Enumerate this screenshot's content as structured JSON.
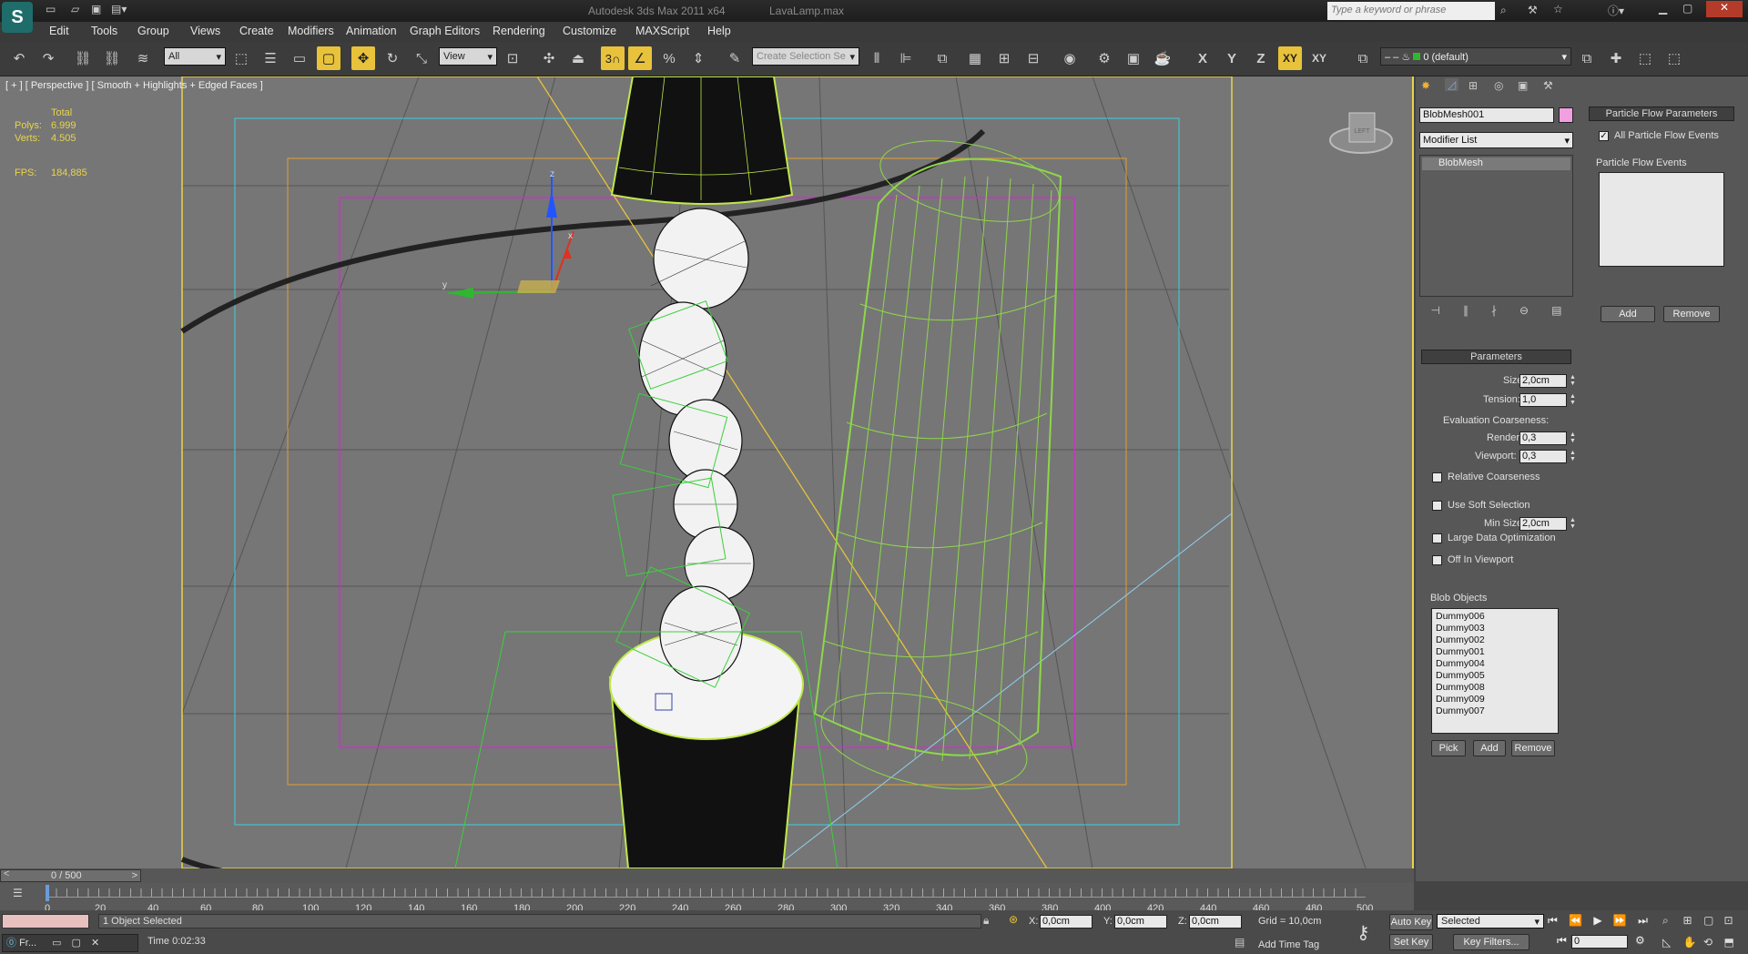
{
  "title": {
    "app": "Autodesk 3ds Max  2011 x64",
    "file": "LavaLamp.max",
    "search_placeholder": "Type a keyword or phrase"
  },
  "menu": [
    "Edit",
    "Tools",
    "Group",
    "Views",
    "Create",
    "Modifiers",
    "Animation",
    "Graph Editors",
    "Rendering",
    "Customize",
    "MAXScript",
    "Help"
  ],
  "toolbar": {
    "filter": "All",
    "ref_coord": "View",
    "snap_count": "3",
    "selection_set_placeholder": "Create Selection Se",
    "axes": [
      "X",
      "Y",
      "Z",
      "XY",
      "XY"
    ],
    "layer": "0 (default)"
  },
  "viewport": {
    "label": "[ + ] [ Perspective ] [ Smooth + Highlights + Edged Faces ]",
    "stats": {
      "header": "Total",
      "polys_label": "Polys:",
      "polys": "6.999",
      "verts_label": "Verts:",
      "verts": "4.505",
      "fps_label": "FPS:",
      "fps": "184,885"
    },
    "gizmo_axes": {
      "x": "x",
      "y": "y",
      "z": "z"
    },
    "viewcube_label": "LEFT"
  },
  "modify_panel": {
    "object_name": "BlobMesh001",
    "modifier_list": "Modifier List",
    "stack_item": "BlobMesh",
    "parameters": {
      "header": "Parameters",
      "size_label": "Size:",
      "size": "2,0cm",
      "tension_label": "Tension:",
      "tension": "1,0",
      "eval_label": "Evaluation Coarseness:",
      "render_label": "Render:",
      "render": "0,3",
      "viewport_label": "Viewport:",
      "viewport": "0,3",
      "relative_coarseness": "Relative Coarseness",
      "use_soft_selection": "Use Soft Selection",
      "min_size_label": "Min Size:",
      "min_size": "2,0cm",
      "large_data": "Large Data Optimization",
      "off_in_viewport": "Off In Viewport",
      "blob_objects_label": "Blob Objects",
      "blob_objects": [
        "Dummy006",
        "Dummy003",
        "Dummy002",
        "Dummy001",
        "Dummy004",
        "Dummy005",
        "Dummy008",
        "Dummy009",
        "Dummy007"
      ],
      "pick": "Pick",
      "add": "Add",
      "remove": "Remove"
    }
  },
  "particle_flow": {
    "header": "Particle Flow Parameters",
    "all_events": "All Particle Flow Events",
    "events_label": "Particle Flow Events",
    "add": "Add",
    "remove": "Remove"
  },
  "timeline": {
    "frame": "0 / 500",
    "ticks": [
      "0",
      "20",
      "40",
      "60",
      "80",
      "100",
      "120",
      "140",
      "160",
      "180",
      "200",
      "220",
      "240",
      "260",
      "280",
      "300",
      "320",
      "340",
      "360",
      "380",
      "400",
      "420",
      "440",
      "460",
      "480",
      "500"
    ]
  },
  "status": {
    "selected": "1 Object Selected",
    "time": "Time  0:02:33",
    "x_label": "X:",
    "x": "0,0cm",
    "y_label": "Y:",
    "y": "0,0cm",
    "z_label": "Z:",
    "z": "0,0cm",
    "grid": "Grid = 10,0cm",
    "add_time_tag": "Add Time Tag",
    "auto_key": "Auto Key",
    "set_key": "Set Key",
    "key_mode": "Selected",
    "key_filters": "Key Filters...",
    "current_frame": "0",
    "taskbar_item": "Fr..."
  }
}
